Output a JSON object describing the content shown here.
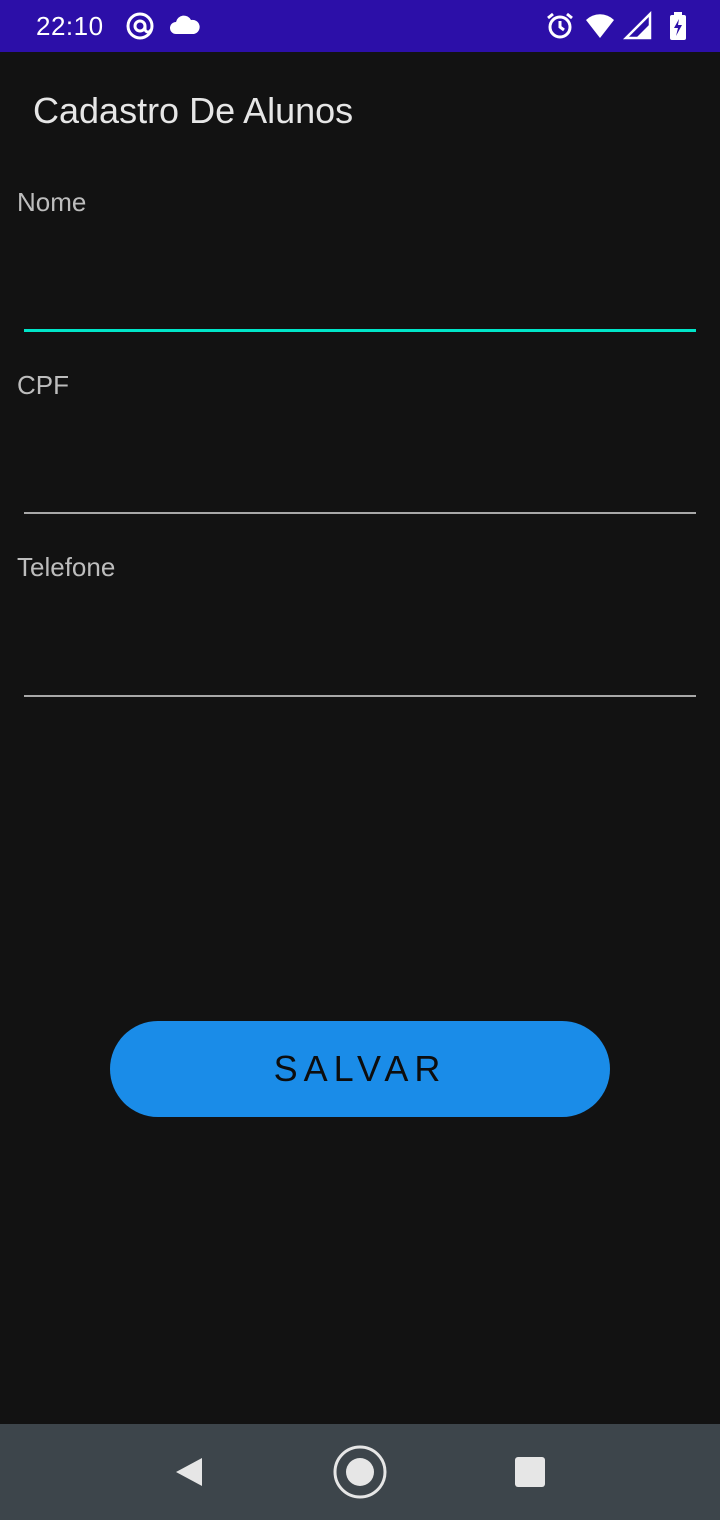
{
  "status_bar": {
    "time": "22:10",
    "icons": [
      "at-sign-icon",
      "cloud-icon",
      "alarm-icon",
      "wifi-icon",
      "signal-icon",
      "battery-charging-icon"
    ],
    "background": "#2c0fa8"
  },
  "app_bar": {
    "title": "Cadastro De Alunos"
  },
  "form": {
    "fields": [
      {
        "label": "Nome",
        "value": "",
        "focused": true
      },
      {
        "label": "CPF",
        "value": "",
        "focused": false
      },
      {
        "label": "Telefone",
        "value": "",
        "focused": false
      }
    ],
    "save_button": "SALVAR"
  },
  "colors": {
    "background": "#121212",
    "accent": "#00e5c8",
    "button": "#1a8ce8",
    "nav_bar": "#3d454b"
  },
  "nav_bar": {
    "buttons": [
      "back-icon",
      "home-icon",
      "recents-icon"
    ]
  }
}
